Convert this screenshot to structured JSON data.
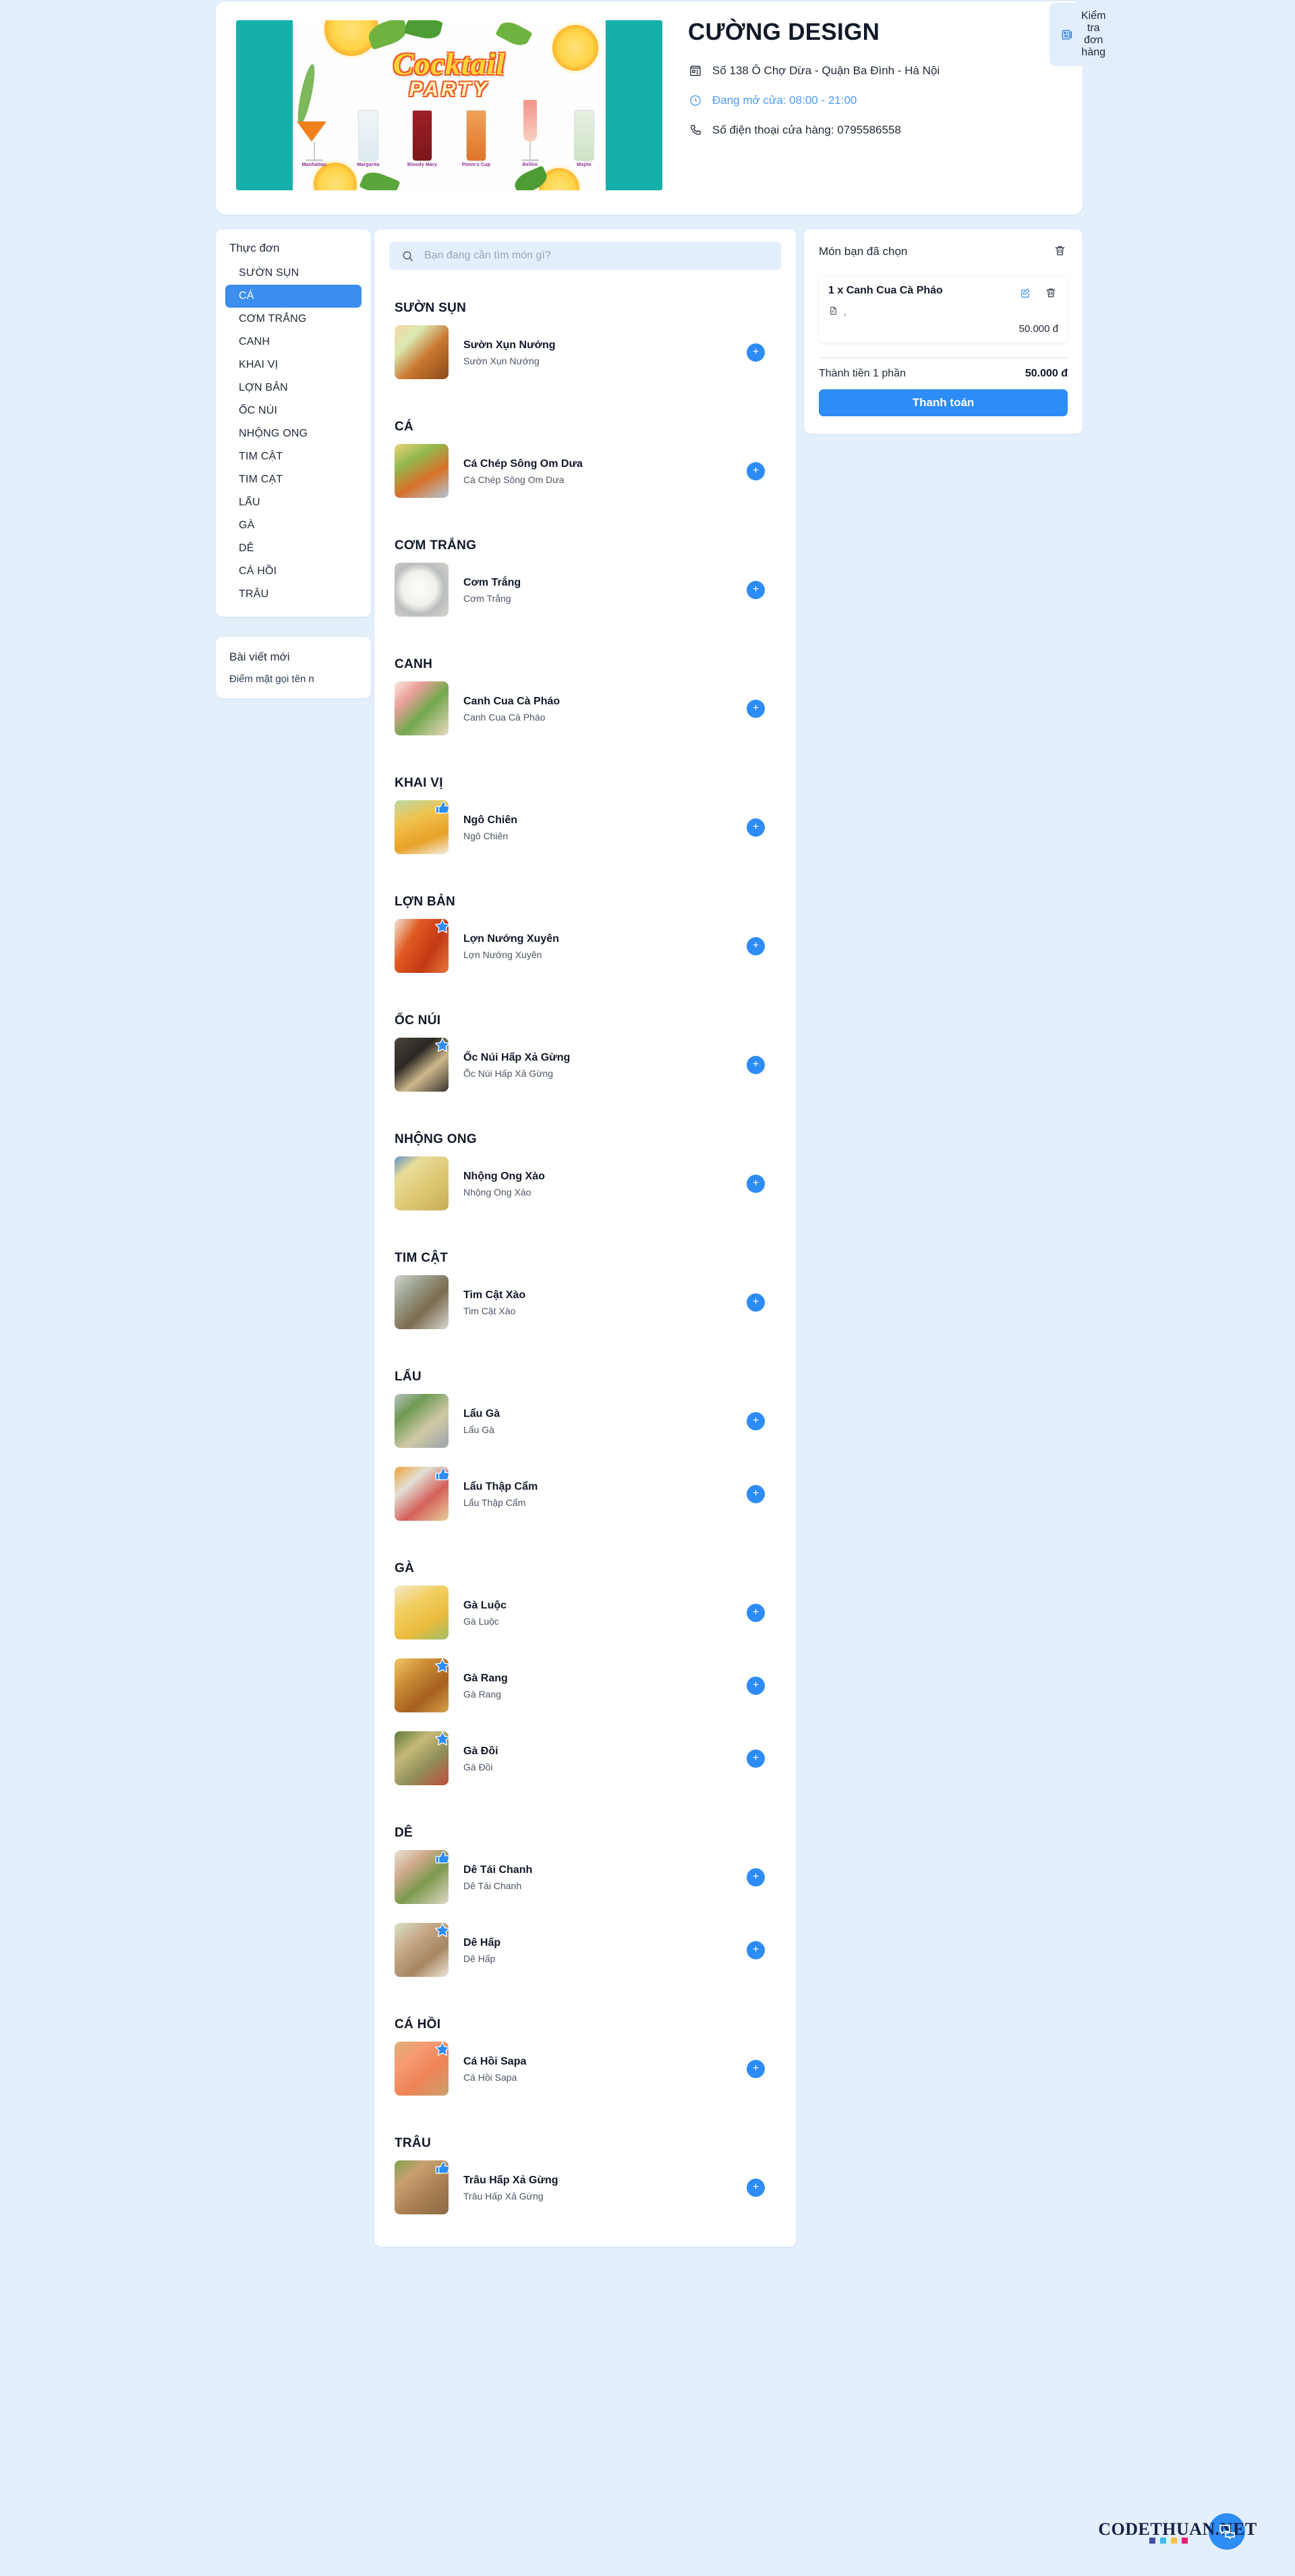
{
  "store": {
    "name": "CƯỜNG DESIGN",
    "address": "Số 138 Ô Chợ Dừa - Quận Ba Đình - Hà Nội",
    "hours": "Đang mở cửa: 08:00 - 21:00",
    "phone": "Số điện thoại cửa hàng: 0795586558",
    "check_order_label": "Kiểm tra đơn hàng",
    "banner": {
      "title": "Cocktail",
      "subtitle": "PARTY",
      "glasses": [
        "Manhattan",
        "Margarita",
        "Bloody Mary",
        "Pimm's Cup",
        "Bellini",
        "Mojito"
      ]
    }
  },
  "sidebar": {
    "title": "Thực đơn",
    "items": [
      {
        "label": "SƯỜN SỤN",
        "active": false
      },
      {
        "label": "CÁ",
        "active": true
      },
      {
        "label": "CƠM TRẮNG",
        "active": false
      },
      {
        "label": "CANH",
        "active": false
      },
      {
        "label": "KHAI VỊ",
        "active": false
      },
      {
        "label": "LỢN BẢN",
        "active": false
      },
      {
        "label": "ỐC NÚI",
        "active": false
      },
      {
        "label": "NHỘNG ONG",
        "active": false
      },
      {
        "label": "TIM CẬT",
        "active": false
      },
      {
        "label": "TIM CẠT",
        "active": false
      },
      {
        "label": "LẨU",
        "active": false
      },
      {
        "label": "GÀ",
        "active": false
      },
      {
        "label": "DÊ",
        "active": false
      },
      {
        "label": "CÁ HỒI",
        "active": false
      },
      {
        "label": "TRÂU",
        "active": false
      }
    ],
    "posts_title": "Bài viết mới",
    "post_link": "Điểm mặt gọi tên n"
  },
  "search": {
    "placeholder": "Bạn đang cần tìm món gì?",
    "value": ""
  },
  "menu": {
    "sections": [
      {
        "title": "SƯỜN SỤN",
        "dishes": [
          {
            "name": "Sườn Xụn Nướng",
            "desc": "Sườn Xụn Nướng",
            "badge": "none",
            "img": "linear-gradient(135deg,#f3d9a8 0%,#d9e8b0 28%,#c9762f 58%,#8a4a19 100%)"
          }
        ]
      },
      {
        "title": "CÁ",
        "dishes": [
          {
            "name": "Cá Chép Sông Om Dưa",
            "desc": "Cá Chép Sông Om Dưa",
            "badge": "none",
            "img": "linear-gradient(150deg,#e9d27a 0%,#93b84d 30%,#d9712b 62%,#b0c7d6 100%)"
          }
        ]
      },
      {
        "title": "CƠM TRẮNG",
        "dishes": [
          {
            "name": "Cơm Trắng",
            "desc": "Cơm Trắng",
            "badge": "none",
            "img": "radial-gradient(circle at 45% 48%,#fdfdfb 0%,#f2f0ea 42%,#b9bdbc 62%,#d9d6cf 100%)"
          }
        ]
      },
      {
        "title": "CANH",
        "dishes": [
          {
            "name": "Canh Cua Cà Pháo",
            "desc": "Canh Cua Cà Pháo",
            "badge": "none",
            "img": "linear-gradient(135deg,#f7ece1 0%,#eb9f9a 26%,#74a84e 56%,#e8d9c2 100%)"
          }
        ]
      },
      {
        "title": "KHAI VỊ",
        "dishes": [
          {
            "name": "Ngô Chiên",
            "desc": "Ngô Chiên",
            "badge": "thumb",
            "img": "linear-gradient(160deg,#bcd9a6 0%,#f0c24f 34%,#e8a128 70%,#f4efe4 100%)"
          }
        ]
      },
      {
        "title": "LỢN BẢN",
        "dishes": [
          {
            "name": "Lợn Nướng Xuyên",
            "desc": "Lợn Nướng Xuyên",
            "badge": "star",
            "img": "linear-gradient(120deg,#f1e7d8 0%,#e05a22 32%,#c23a14 66%,#e8763a 100%)"
          }
        ]
      },
      {
        "title": "ỐC NÚI",
        "dishes": [
          {
            "name": "Ốc Núi Hấp Xả Gừng",
            "desc": "Ốc Núi Hấp Xả Gừng",
            "badge": "star",
            "img": "linear-gradient(140deg,#4a443c 0%,#2b2723 35%,#cdb88c 62%,#3a352f 100%)"
          }
        ]
      },
      {
        "title": "NHỘNG ONG",
        "dishes": [
          {
            "name": "Nhộng Ong Xào",
            "desc": "Nhộng Ong Xào",
            "badge": "none",
            "img": "linear-gradient(140deg,#5f8fc4 0%,#e8dc9a 24%,#ddc771 60%,#c8ad55 100%)"
          }
        ]
      },
      {
        "title": "TIM CẬT",
        "dishes": [
          {
            "name": "Tim Cật Xào",
            "desc": "Tim Cật Xào",
            "badge": "none",
            "img": "linear-gradient(135deg,#cfd3cd 0%,#9aa08c 30%,#7b6a4e 60%,#d4d8cf 100%)"
          }
        ]
      },
      {
        "title": "LẨU",
        "dishes": [
          {
            "name": "Lẩu Gà",
            "desc": "Lẩu Gà",
            "badge": "none",
            "img": "linear-gradient(140deg,#b8c0c4 0%,#6f9a53 28%,#cfc9a6 62%,#9aa4a8 100%)"
          },
          {
            "name": "Lẩu Thập Cẩm",
            "desc": "Lẩu Thập Cẩm",
            "badge": "thumb",
            "img": "linear-gradient(140deg,#eba23a 0%,#e2e0d6 30%,#d4605a 62%,#e7cf9c 100%)"
          }
        ]
      },
      {
        "title": "GÀ",
        "dishes": [
          {
            "name": "Gà Luộc",
            "desc": "Gà Luộc",
            "badge": "none",
            "img": "linear-gradient(150deg,#f6e9c9 0%,#f2cf62 34%,#e9bb3c 68%,#9fbf6a 100%)"
          },
          {
            "name": "Gà Rang",
            "desc": "Gà Rang",
            "badge": "star",
            "img": "linear-gradient(140deg,#f0c463 0%,#c98a33 34%,#a5601f 66%,#d8a14a 100%)"
          },
          {
            "name": "Gà Đồi",
            "desc": "Gà Đồi",
            "badge": "star",
            "img": "linear-gradient(140deg,#5f7a3a 0%,#c5b978 32%,#8f8f5a 62%,#c14c3a 100%)"
          }
        ]
      },
      {
        "title": "DÊ",
        "dishes": [
          {
            "name": "Dê Tái Chanh",
            "desc": "Dê Tái Chanh",
            "badge": "thumb",
            "img": "linear-gradient(140deg,#e9e4d8 0%,#cfa98c 30%,#7d9a4e 58%,#e0d6c6 100%)"
          },
          {
            "name": "Dê Hấp",
            "desc": "Dê Hấp",
            "badge": "star",
            "img": "linear-gradient(140deg,#d9e3c6 0%,#c6a887 34%,#a78661 66%,#eee8dc 100%)"
          }
        ]
      },
      {
        "title": "CÁ HỒI",
        "dishes": [
          {
            "name": "Cá Hồi Sapa",
            "desc": "Cá Hồi Sapa",
            "badge": "star",
            "img": "linear-gradient(140deg,#e0b07a 0%,#f59a72 30%,#ef8457 60%,#c9a06a 100%)"
          }
        ]
      },
      {
        "title": "TRÂU",
        "dishes": [
          {
            "name": "Trâu Hấp Xả Gừng",
            "desc": "Trâu Hấp Xả Gừng",
            "badge": "thumb",
            "img": "linear-gradient(140deg,#7fa34e 0%,#c9a070 28%,#a97f52 62%,#8c6a45 100%)"
          }
        ]
      }
    ],
    "add_label": "+"
  },
  "cart": {
    "title": "Món bạn đã chọn",
    "items": [
      {
        "name": "1 x Canh Cua Cà Pháo",
        "note": ",",
        "price": "50.000 đ"
      }
    ],
    "total_label": "Thành tiền 1 phần",
    "total_value": "50.000 đ",
    "pay_label": "Thanh toán"
  },
  "watermark": {
    "text": "CODETHUAN.NET"
  },
  "colors": {
    "page_bg": "#e3effb",
    "accent": "#2d8cf5",
    "active_nav": "#3b8dee",
    "open_status": "#4b9af0",
    "banner_teal": "#16b0ab"
  }
}
